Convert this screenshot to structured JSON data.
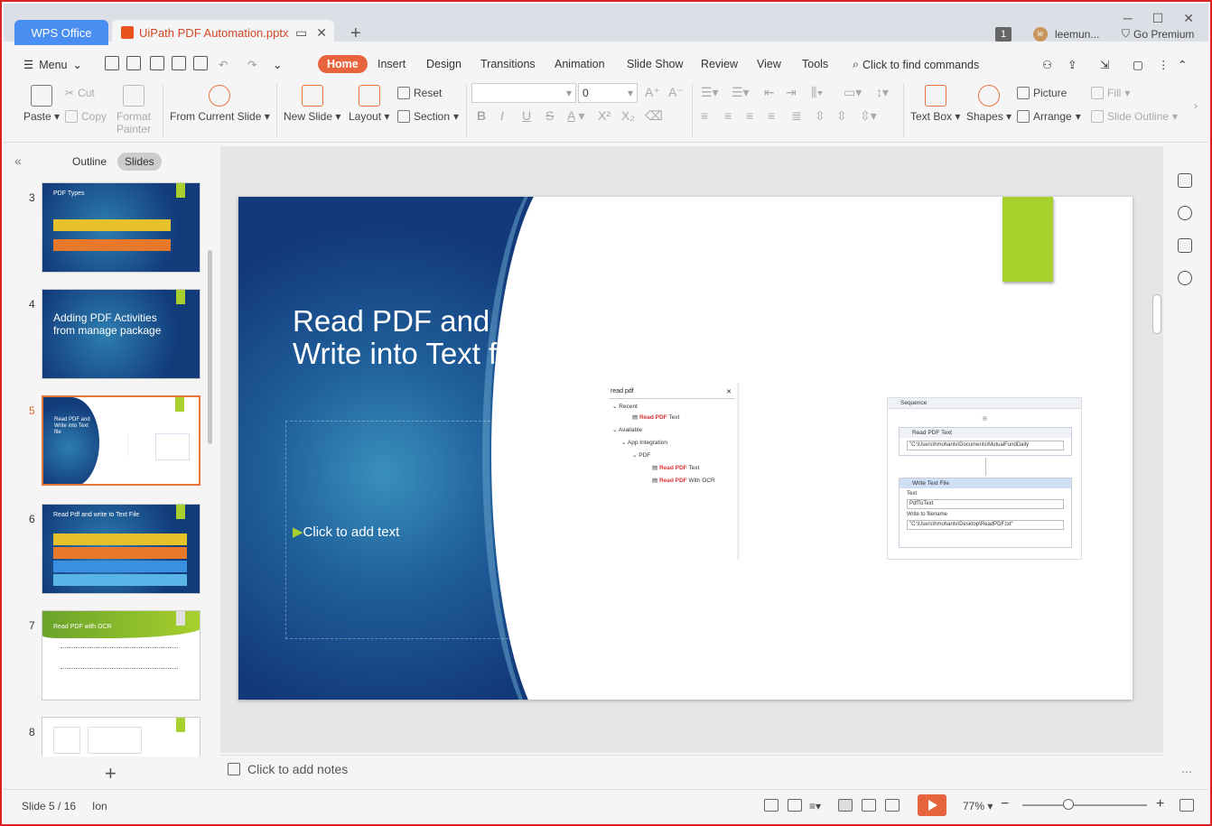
{
  "titlebar": {
    "wps_tab": "WPS Office",
    "doc_tab": "UiPath PDF Automation.pptx",
    "new_tab": "+",
    "badge": "1",
    "user_initial": "le",
    "user": "leemun...",
    "premium": "Go Premium"
  },
  "menu": {
    "menu_label": "Menu",
    "tabs": [
      "Home",
      "Insert",
      "Design",
      "Transitions",
      "Animation",
      "Slide Show",
      "Review",
      "View",
      "Tools"
    ],
    "search": "Click to find commands"
  },
  "ribbon": {
    "paste": "Paste",
    "cut": "Cut",
    "copy": "Copy",
    "format_painter_1": "Format",
    "format_painter_2": "Painter",
    "from_current": "From Current Slide",
    "new_slide": "New Slide",
    "layout": "Layout",
    "reset": "Reset",
    "section": "Section",
    "font_size": "0",
    "text_box": "Text Box",
    "shapes": "Shapes",
    "picture": "Picture",
    "fill": "Fill",
    "arrange": "Arrange",
    "slide_outline": "Slide Outline"
  },
  "leftpanel": {
    "outline": "Outline",
    "slides": "Slides",
    "thumbs": [
      {
        "num": "3",
        "title": "PDF Types"
      },
      {
        "num": "4",
        "title": "Adding PDF Activities from manage package"
      },
      {
        "num": "5",
        "title": "Read PDF and Write into Text file"
      },
      {
        "num": "6",
        "title": "Read Pdf and write to Text File"
      },
      {
        "num": "7",
        "title": "Read PDF with OCR"
      },
      {
        "num": "8",
        "title": ""
      }
    ],
    "add": "+"
  },
  "slide": {
    "title": "Read PDF and Write into Text file",
    "add_text": "Click to add text",
    "bullet": "▶"
  },
  "screenshot": {
    "search": "read pdf",
    "recent": "Recent",
    "available": "Available",
    "app_integration": "App Integration",
    "pdf": "PDF",
    "read_pdf": "Read PDF",
    "text": "Text",
    "with_ocr": "With OCR",
    "sequence": "Sequence",
    "read_pdf_text": "Read PDF Text",
    "read_path": "\"C:\\Users\\hmohantv\\Documents\\MutualFundDaily",
    "write_text_file": "Write Text File",
    "text_label": "Text",
    "text_value": "PdfToText",
    "write_to": "Write to filename",
    "write_path": "\"C:\\Users\\hmohantv\\Desktop\\ReadPDF.txt\""
  },
  "notes": {
    "placeholder": "Click to add notes"
  },
  "status": {
    "slide": "Slide 5 / 16",
    "theme": "Ion",
    "zoom": "77%",
    "zoom_level": 0.37
  }
}
